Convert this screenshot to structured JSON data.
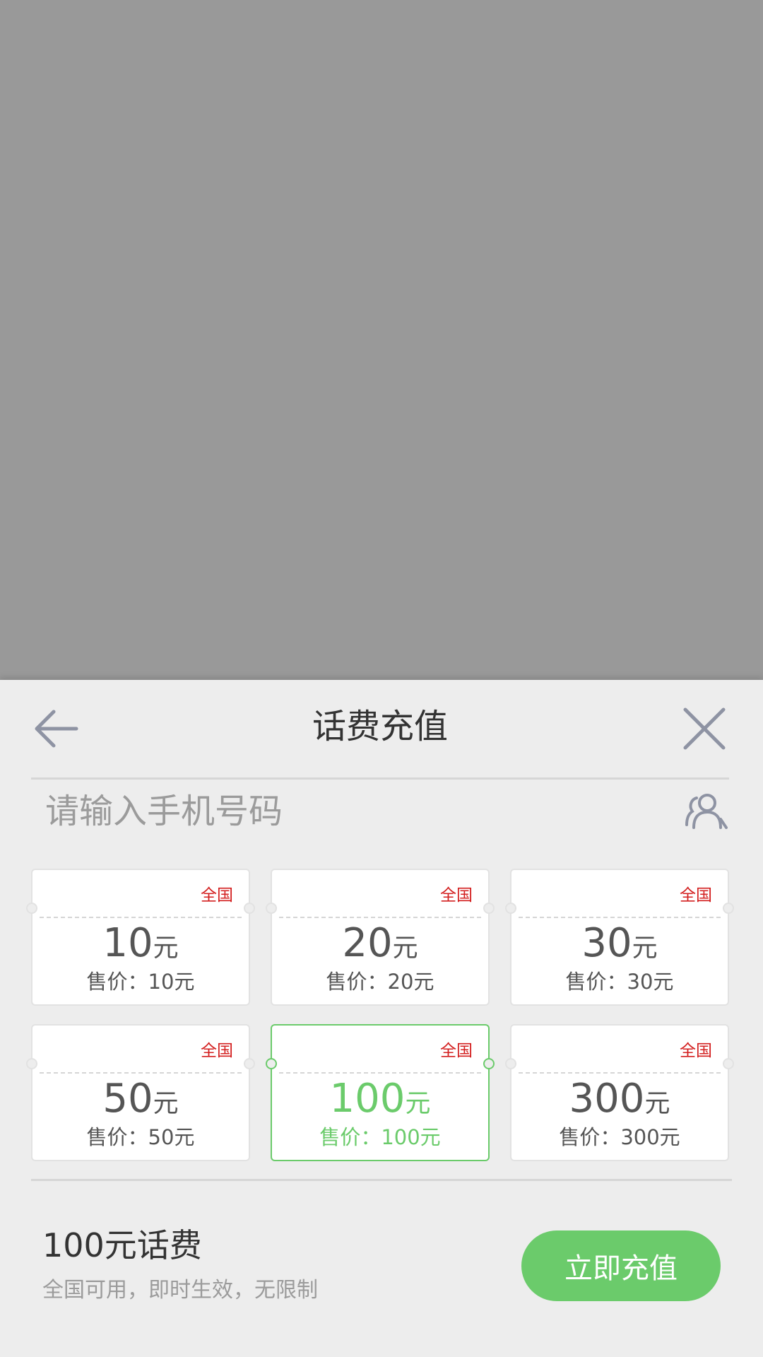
{
  "header": {
    "title": "话费充值",
    "back_icon": "arrow-left-icon",
    "close_icon": "close-icon"
  },
  "phone_input": {
    "value": "",
    "placeholder": "请输入手机号码",
    "contacts_icon": "contacts-icon"
  },
  "colors": {
    "accent": "#6bcb6b",
    "badge": "#d31f1f",
    "text": "#555555",
    "placeholder": "#9b9b9b",
    "overlay": "#999999",
    "sheet": "#ededed"
  },
  "cards": [
    {
      "badge": "全国",
      "amount": "10",
      "unit": "元",
      "price": "售价：10元",
      "selected": false
    },
    {
      "badge": "全国",
      "amount": "20",
      "unit": "元",
      "price": "售价：20元",
      "selected": false
    },
    {
      "badge": "全国",
      "amount": "30",
      "unit": "元",
      "price": "售价：30元",
      "selected": false
    },
    {
      "badge": "全国",
      "amount": "50",
      "unit": "元",
      "price": "售价：50元",
      "selected": false
    },
    {
      "badge": "全国",
      "amount": "100",
      "unit": "元",
      "price": "售价：100元",
      "selected": true
    },
    {
      "badge": "全国",
      "amount": "300",
      "unit": "元",
      "price": "售价：300元",
      "selected": false
    }
  ],
  "summary": {
    "title": "100元话费",
    "description": "全国可用，即时生效，无限制",
    "button_label": "立即充值"
  }
}
